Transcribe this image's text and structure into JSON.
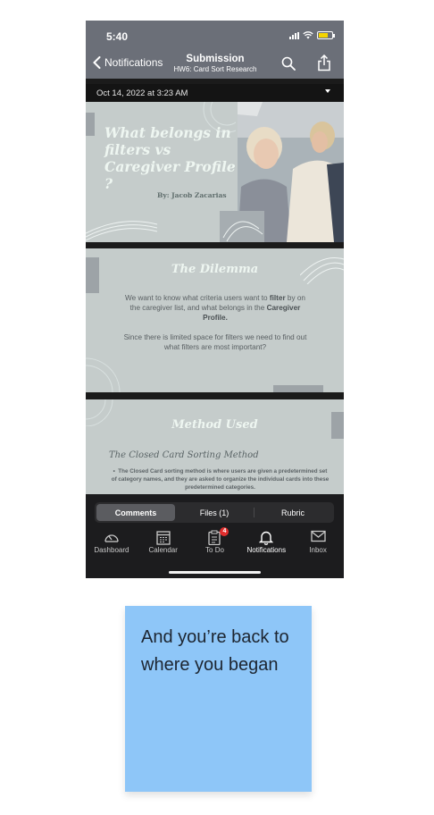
{
  "status": {
    "time": "5:40"
  },
  "nav": {
    "back_label": "Notifications",
    "title": "Submission",
    "subtitle": "HW6: Card Sort Research"
  },
  "submission": {
    "date": "Oct 14, 2022 at 3:23 AM"
  },
  "slides": {
    "s1": {
      "title": "What belongs in filters vs Caregiver Profile ?",
      "byline": "By: Jacob Zacarias"
    },
    "s2": {
      "title": "The Dilemma",
      "p1_a": "We want to know what criteria users want to ",
      "p1_b": "filter",
      "p1_c": " by on the caregiver list, and what belongs in the ",
      "p1_d": "Caregiver Profile.",
      "p2": "Since there is limited space for filters we need to find out what filters are most important?"
    },
    "s3": {
      "title": "Method Used",
      "subtitle": "The Closed Card Sorting Method",
      "bullet": "The Closed Card sorting method is where users are given a predetermined set of category names, and they are asked to organize the individual cards into these predetermined categories."
    }
  },
  "segmented": {
    "comments": "Comments",
    "files": "Files (1)",
    "rubric": "Rubric",
    "active": "Comments"
  },
  "tabs": {
    "dashboard": "Dashboard",
    "calendar": "Calendar",
    "todo": "To Do",
    "todo_badge": "4",
    "notifications": "Notifications",
    "inbox": "Inbox",
    "active": "Notifications"
  },
  "note": {
    "text": "And you’re back to where you began"
  },
  "colors": {
    "header": "#6b6f78",
    "slide_bg": "#c5cccb",
    "badge": "#e02e2e",
    "note": "#8ec6f8"
  }
}
